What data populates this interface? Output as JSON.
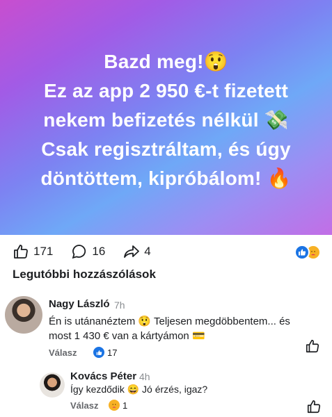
{
  "post": {
    "lines": [
      "Bazd meg!😲",
      "Ez az app 2 950 €-t fizetett",
      "nekem befizetés nélkül 💸",
      "Csak regisztráltam, és úgy",
      "döntöttem, kipróbálom! 🔥"
    ]
  },
  "stats": {
    "likes": "171",
    "comments": "16",
    "shares": "4"
  },
  "section_title": "Legutóbbi hozzászólások",
  "comments": [
    {
      "name": "Nagy László",
      "time": "7h",
      "text_line1": "Én is utánanéztem 😲 Teljesen megdöbbentem... és",
      "text_line2": "most 1 430 € van a kártyámon 💳",
      "reply_label": "Válasz",
      "reactions": "17"
    },
    {
      "name": "Kovács Péter",
      "time": "4h",
      "text": "Így kezdődik 😄 Jó érzés, igaz?",
      "reply_label": "Válasz",
      "reactions": "1"
    }
  ],
  "colors": {
    "accent": "#1b74e4",
    "care": "#f7b125",
    "muted": "#65676b"
  }
}
